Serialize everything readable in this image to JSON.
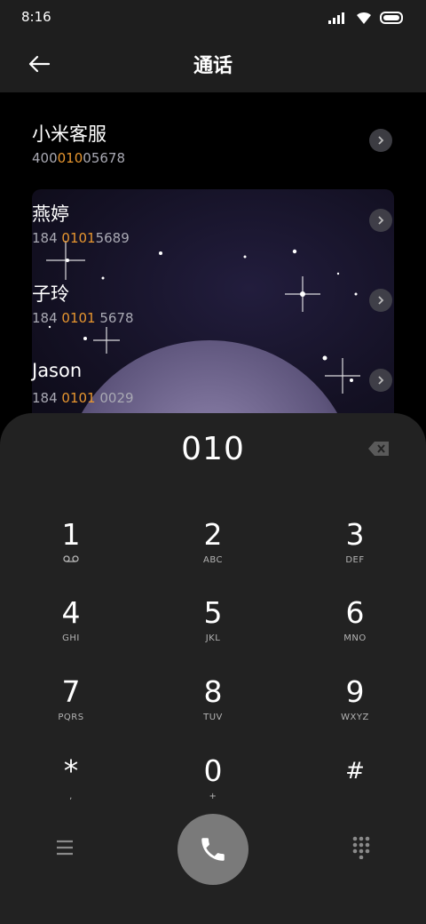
{
  "status_bar": {
    "time": "8:16"
  },
  "header": {
    "title": "通话",
    "back_icon": "back-arrow-icon"
  },
  "contacts": [
    {
      "name": "小米客服",
      "number_parts": [
        "400",
        "010",
        "05678"
      ]
    },
    {
      "name": "燕婷",
      "number_parts": [
        "184 ",
        "0101",
        "5689"
      ]
    },
    {
      "name": "子玲",
      "number_parts": [
        "184 ",
        "0101",
        " 5678"
      ]
    },
    {
      "name": "Jason",
      "number_parts": [
        "184 ",
        "0101",
        " 0029"
      ]
    }
  ],
  "dialer": {
    "input": "010",
    "keys": [
      {
        "num": "1",
        "sub": ""
      },
      {
        "num": "2",
        "sub": "ABC"
      },
      {
        "num": "3",
        "sub": "DEF"
      },
      {
        "num": "4",
        "sub": "GHI"
      },
      {
        "num": "5",
        "sub": "JKL"
      },
      {
        "num": "6",
        "sub": "MNO"
      },
      {
        "num": "7",
        "sub": "PQRS"
      },
      {
        "num": "8",
        "sub": "TUV"
      },
      {
        "num": "9",
        "sub": "WXYZ"
      },
      {
        "num": "*",
        "sub": ","
      },
      {
        "num": "0",
        "sub": "+"
      },
      {
        "num": "#",
        "sub": ""
      }
    ]
  },
  "colors": {
    "highlight": "#e8962f",
    "pad_bg": "#222222",
    "call_button": "#7a7a7a"
  }
}
